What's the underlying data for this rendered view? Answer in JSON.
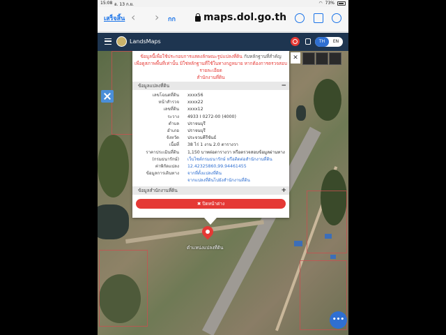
{
  "status_bar": {
    "time": "15:08",
    "date": "อ. 13 ก.ย.",
    "battery": "73%"
  },
  "browser": {
    "done_label": "เสร็จสิ้น",
    "aa_label": "กก",
    "url": "maps.dol.go.th"
  },
  "app": {
    "brand": "LandsMaps",
    "lang_th": "TH",
    "lang_en": "EN"
  },
  "panel": {
    "notice_line1": "ข้อมูลนี้เพื่อใช้ประกอบการแสดงลักษณะรูปแปลงที่ดิน",
    "notice_line1_right": "กับหลักฐานที่สำคัญ",
    "notice_line2": "เพื่อดูสภาพพื้นที่เท่านั้น มิใช่หลักฐานที่ใช้ในทางกฎหมาย หากต้องการตรวจสอบรายละเอียด",
    "notice_line3": "สำนักงานที่ดิน",
    "section1_title": "ข้อมูลแปลงที่ดิน",
    "section1_toggle": "−",
    "section2_title": "ข้อมูลสำนักงานที่ดิน",
    "section2_toggle": "+",
    "close_label": "✖ ปิดหน้าต่าง",
    "rows": [
      {
        "key": "เลขโฉนดที่ดิน",
        "value": "xxxx56",
        "link": false
      },
      {
        "key": "หน้าสำรวจ",
        "value": "xxxx22",
        "link": false
      },
      {
        "key": "เลขที่ดิน",
        "value": "xxxx12",
        "link": false
      },
      {
        "key": "ระวาง",
        "value": "4933 I 0272-00 (4000)",
        "link": false
      },
      {
        "key": "ตำบล",
        "value": "ปราจนบุรี",
        "link": false
      },
      {
        "key": "อำเภอ",
        "value": "ปราจนบุรี",
        "link": false
      },
      {
        "key": "จังหวัด",
        "value": "ประจวบคีรีขันธ์",
        "link": false
      },
      {
        "key": "เนื้อที่",
        "value": "38 ไร่ 1 งาน 2.0 ตารางวา",
        "link": false
      },
      {
        "key": "ราคาประเมินที่ดิน",
        "value": "1,150 บาทต่อตารางวา หรือตรวจสอบข้อมูลผ่านทาง",
        "link": false
      },
      {
        "key": "(กรมธนารักษ์)",
        "value": "เว็บไซต์กรมธนารักษ์ หรือติดต่อสำนักงานที่ดิน",
        "link": true
      },
      {
        "key": "ค่าพิกัดแปลง",
        "value": "12.42325860,99.94461455",
        "link": true
      },
      {
        "key": "ข้อมูลการเดินทาง",
        "value": "จากที่ตั้งแปลงที่ดิน",
        "link": true
      },
      {
        "key": "",
        "value": "จากแปลงที่ดินไปยังสำนักงานที่ดิน",
        "link": true
      }
    ]
  },
  "map": {
    "marker_label": "ตำแหน่งแปลงที่ดิน",
    "fab_label": "•••"
  },
  "colors": {
    "header": "#1e3550",
    "accent": "#2f6fd1",
    "danger": "#e53935"
  }
}
